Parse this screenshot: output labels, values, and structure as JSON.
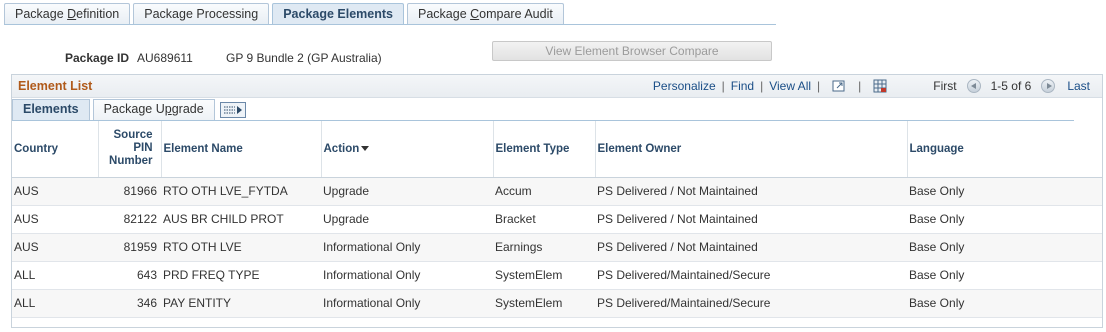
{
  "tabs": [
    {
      "pre": "Package ",
      "u": "D",
      "post": "efinition"
    },
    {
      "pre": "Package Processing",
      "u": "",
      "post": ""
    },
    {
      "pre": "Package Elements",
      "u": "",
      "post": ""
    },
    {
      "pre": "Package ",
      "u": "C",
      "post": "ompare Audit"
    }
  ],
  "package": {
    "id_label": "Package ID",
    "id_value": "AU689611",
    "description": "GP 9 Bundle 2 (GP Australia)",
    "compare_button": "View Element Browser Compare"
  },
  "grid": {
    "title": "Element List",
    "personalize": "Personalize",
    "find": "Find",
    "view_all": "View All",
    "first": "First",
    "range": "1-5 of 6",
    "last": "Last",
    "sub_tabs": [
      {
        "pre": "Elements",
        "u": "",
        "post": ""
      },
      {
        "pre": "Package U",
        "u": "p",
        "post": "grade"
      }
    ],
    "columns": {
      "country": "Country",
      "pin_1": "Source",
      "pin_2": "PIN",
      "pin_3": "Number",
      "name": "Element Name",
      "action": "Action",
      "type": "Element Type",
      "owner": "Element Owner",
      "language": "Language"
    },
    "rows": [
      {
        "country": "AUS",
        "pin": "81966",
        "name": "RTO OTH LVE_FYTDA",
        "action": "Upgrade",
        "type": "Accum",
        "owner": "PS Delivered / Not Maintained",
        "language": "Base Only"
      },
      {
        "country": "AUS",
        "pin": "82122",
        "name": "AUS BR CHILD PROT",
        "action": "Upgrade",
        "type": "Bracket",
        "owner": "PS Delivered / Not Maintained",
        "language": "Base Only"
      },
      {
        "country": "AUS",
        "pin": "81959",
        "name": "RTO OTH LVE",
        "action": "Informational Only",
        "type": "Earnings",
        "owner": "PS Delivered / Not Maintained",
        "language": "Base Only"
      },
      {
        "country": "ALL",
        "pin": "643",
        "name": "PRD FREQ TYPE",
        "action": "Informational Only",
        "type": "SystemElem",
        "owner": "PS Delivered/Maintained/Secure",
        "language": "Base Only"
      },
      {
        "country": "ALL",
        "pin": "346",
        "name": "PAY ENTITY",
        "action": "Informational Only",
        "type": "SystemElem",
        "owner": "PS Delivered/Maintained/Secure",
        "language": "Base Only"
      }
    ]
  },
  "colors": {
    "accent": "#2c4a68",
    "title": "#b05a1a",
    "link": "#1a4e87"
  }
}
